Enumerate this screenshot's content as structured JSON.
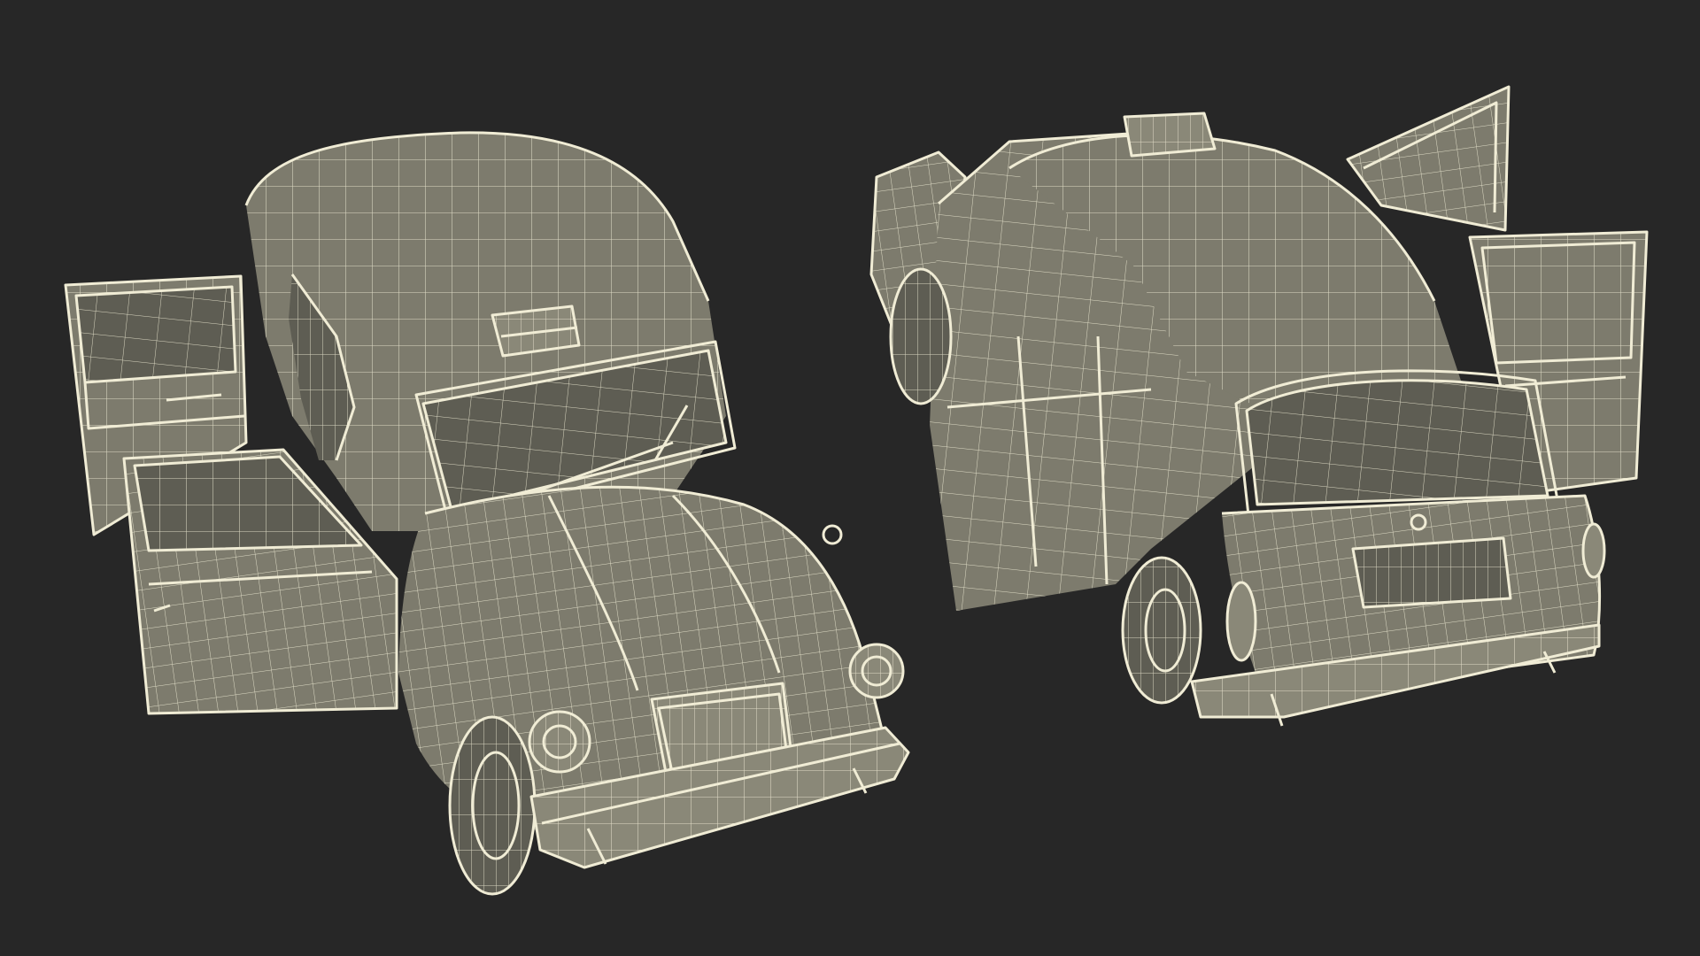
{
  "scene": {
    "background": "#272727",
    "wire_color": "#f0ecd5",
    "surface_color": "#7d7b6d",
    "render_style": "wireframe over shaded clay"
  }
}
